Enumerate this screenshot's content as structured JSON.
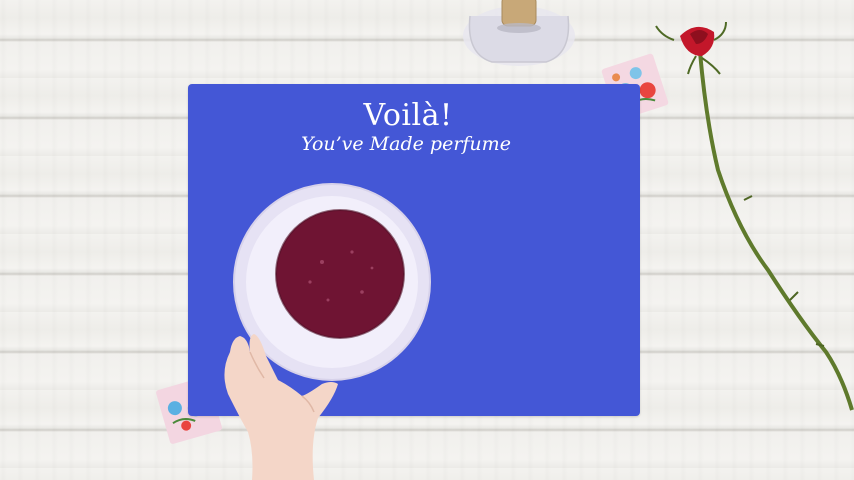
{
  "overlay": {
    "title": "Voilà!",
    "subtitle": "You’ve Made perfume"
  },
  "colors": {
    "mat": "#4457d6",
    "liquid": "#6f1433",
    "bowl": "#f1eefb",
    "rose": "#c3172a",
    "wood": "#efeeeb"
  }
}
